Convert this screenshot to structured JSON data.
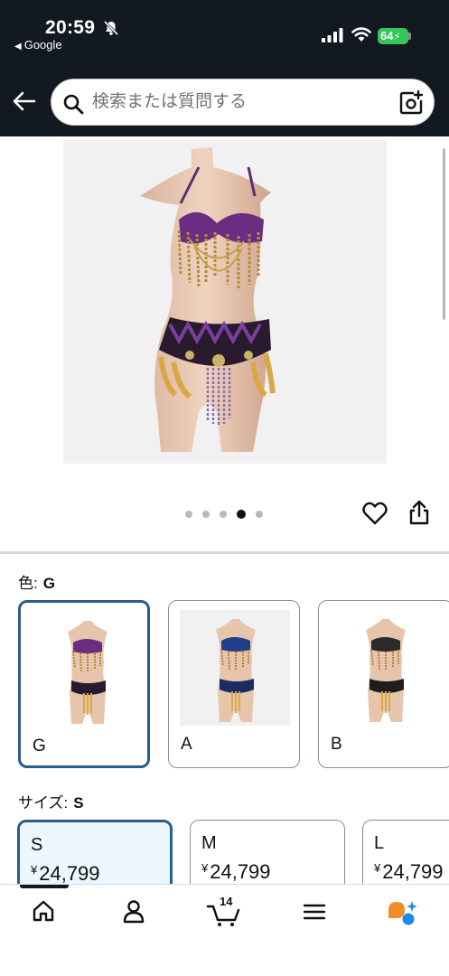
{
  "status_bar": {
    "time": "20:59",
    "back_app": "Google",
    "battery": "64",
    "battery_color": "#33c759"
  },
  "header": {
    "background_color": "#131921",
    "search_placeholder": "検索または質問する"
  },
  "gallery": {
    "image_count": 5,
    "active_index": 3
  },
  "color_selector": {
    "label": "色:",
    "selected": "G",
    "options": [
      {
        "name": "G",
        "selected": true
      },
      {
        "name": "A",
        "selected": false
      },
      {
        "name": "B",
        "selected": false
      }
    ]
  },
  "size_selector": {
    "label": "サイズ:",
    "selected": "S",
    "options": [
      {
        "size": "S",
        "currency": "¥",
        "price": "24,799",
        "selected": true
      },
      {
        "size": "M",
        "currency": "¥",
        "price": "24,799",
        "selected": false
      },
      {
        "size": "L",
        "currency": "¥",
        "price": "24,799",
        "selected": false
      }
    ]
  },
  "tab_bar": {
    "items": [
      {
        "icon": "home-icon",
        "active": true
      },
      {
        "icon": "account-icon",
        "active": false
      },
      {
        "icon": "cart-icon",
        "active": false
      },
      {
        "icon": "menu-icon",
        "active": false
      },
      {
        "icon": "rufus-assistant-icon",
        "active": false
      }
    ],
    "cart_count": "14"
  }
}
